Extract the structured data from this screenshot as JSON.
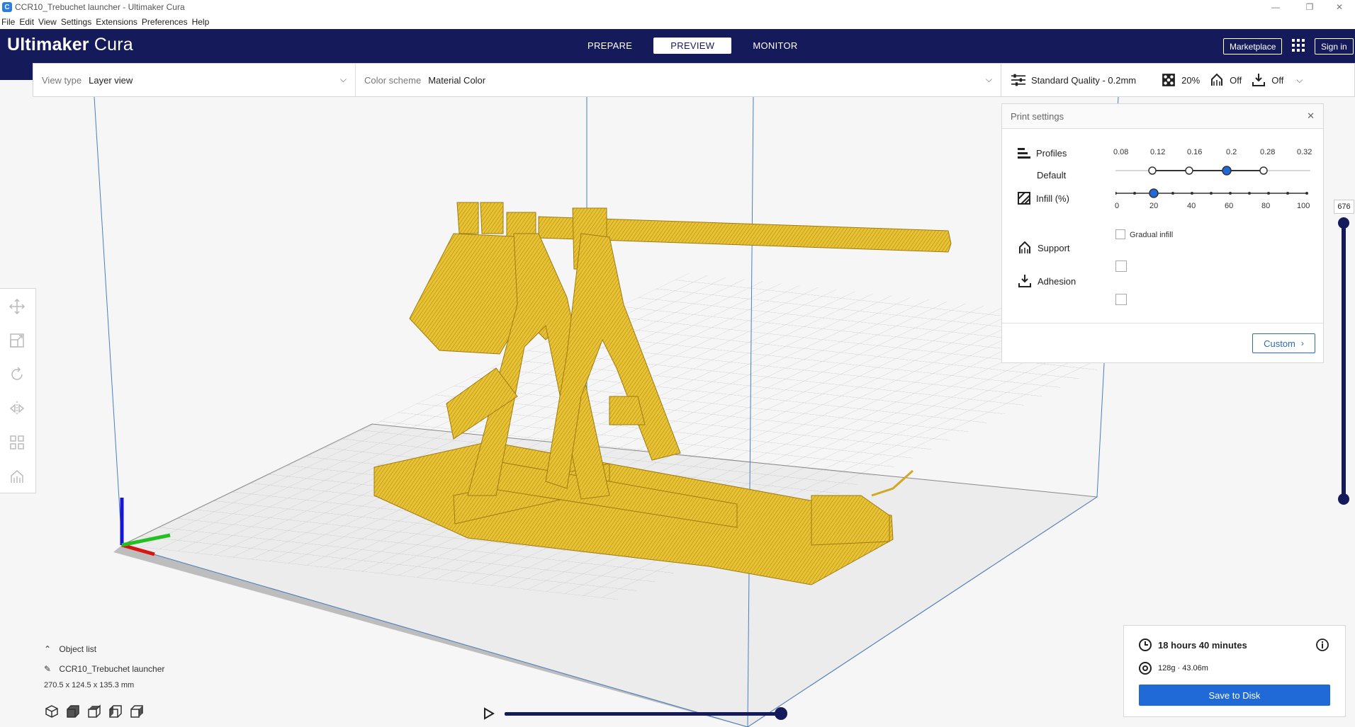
{
  "window": {
    "title": "CCR10_Trebuchet launcher - Ultimaker Cura",
    "minimize": "—",
    "restore": "❐",
    "close": "✕"
  },
  "menu": [
    "File",
    "Edit",
    "View",
    "Settings",
    "Extensions",
    "Preferences",
    "Help"
  ],
  "header": {
    "logo_bold": "Ultimaker",
    "logo_light": "Cura",
    "stages": [
      "PREPARE",
      "PREVIEW",
      "MONITOR"
    ],
    "active_stage": "PREVIEW",
    "marketplace_label": "Marketplace",
    "signin_label": "Sign in"
  },
  "viewbar": {
    "view_type_label": "View type",
    "view_type_value": "Layer view",
    "color_scheme_label": "Color scheme",
    "color_scheme_value": "Material Color"
  },
  "quality": {
    "profile": "Standard Quality - 0.2mm",
    "infill": "20%",
    "support": "Off",
    "adhesion": "Off"
  },
  "print_settings": {
    "title": "Print settings",
    "profiles_label": "Profiles",
    "profile_default": "Default",
    "profile_ticks": [
      "0.08",
      "0.12",
      "0.16",
      "0.2",
      "0.28",
      "0.32"
    ],
    "profile_selected": "0.2",
    "infill_label": "Infill (%)",
    "infill_ticks": [
      "0",
      "20",
      "40",
      "60",
      "80",
      "100"
    ],
    "infill_value": 20,
    "gradual_infill_label": "Gradual infill",
    "gradual_infill_checked": false,
    "support_label": "Support",
    "support_checked": false,
    "adhesion_label": "Adhesion",
    "adhesion_checked": false,
    "custom_label": "Custom"
  },
  "layer_slider": {
    "value": "676"
  },
  "object_list": {
    "toggle_label": "Object list",
    "object_name": "CCR10_Trebuchet launcher",
    "dimensions": "270.5 x 124.5 x 135.3 mm"
  },
  "job": {
    "time": "18 hours 40 minutes",
    "material": "128g · 43.06m",
    "save_label": "Save to Disk"
  },
  "colors": {
    "header_bg": "#151a5a",
    "accent_blue": "#1f6ad6",
    "model_yellow": "#e8c334"
  }
}
